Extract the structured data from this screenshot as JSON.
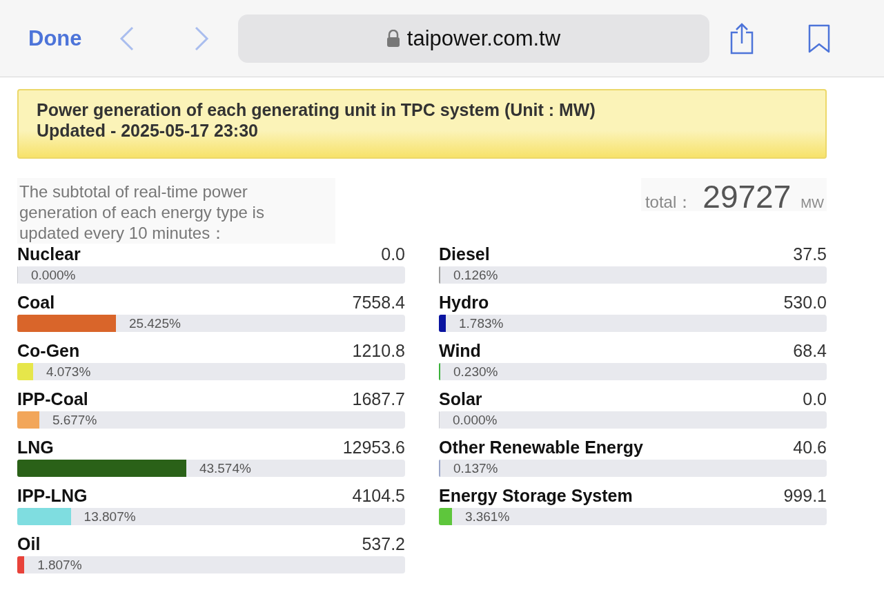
{
  "browser": {
    "done_label": "Done",
    "url": "taipower.com.tw"
  },
  "header": {
    "title": "Power generation of each generating unit in TPC system (Unit : MW)",
    "updated": "Updated - 2025-05-17 23:30"
  },
  "note": "The subtotal of real-time power generation of each energy type is updated every 10 minutes：",
  "total": {
    "label": "total：",
    "value": "29727",
    "unit": "MW"
  },
  "columns": [
    {
      "items": [
        {
          "name": "Nuclear",
          "value": "0.0",
          "percent": "0.000%",
          "level": 0
        },
        {
          "name": "Coal",
          "value": "7558.4",
          "percent": "25.425%",
          "level": 0.25425,
          "color": "#d9652a"
        },
        {
          "name": "Co-Gen",
          "value": "1210.8",
          "percent": "4.073%",
          "level": 0.04073,
          "color": "#e6e64a"
        },
        {
          "name": "IPP-Coal",
          "value": "1687.7",
          "percent": "5.677%",
          "level": 0.05677,
          "color": "#f2a65a"
        },
        {
          "name": "LNG",
          "value": "12953.6",
          "percent": "43.574%",
          "level": 0.43574,
          "color": "#2a6118"
        },
        {
          "name": "IPP-LNG",
          "value": "4104.5",
          "percent": "13.807%",
          "level": 0.13807,
          "color": "#7fdde0"
        },
        {
          "name": "Oil",
          "value": "537.2",
          "percent": "1.807%",
          "level": 0.01807,
          "color": "#e8433a"
        }
      ]
    },
    {
      "items": [
        {
          "name": "Diesel",
          "value": "37.5",
          "percent": "0.126%",
          "level": 0.00126,
          "color": "#9a9a9a"
        },
        {
          "name": "Hydro",
          "value": "530.0",
          "percent": "1.783%",
          "level": 0.01783,
          "color": "#0a14a0"
        },
        {
          "name": "Wind",
          "value": "68.4",
          "percent": "0.230%",
          "level": 0.0023,
          "color": "#3bb13b"
        },
        {
          "name": "Solar",
          "value": "0.0",
          "percent": "0.000%",
          "level": 0
        },
        {
          "name": "Other Renewable Energy",
          "value": "40.6",
          "percent": "0.137%",
          "level": 0.00137,
          "color": "#9aa6c8"
        },
        {
          "name": "Energy Storage System",
          "value": "999.1",
          "percent": "3.361%",
          "level": 0.03361,
          "color": "#5ec63c"
        }
      ]
    }
  ]
}
